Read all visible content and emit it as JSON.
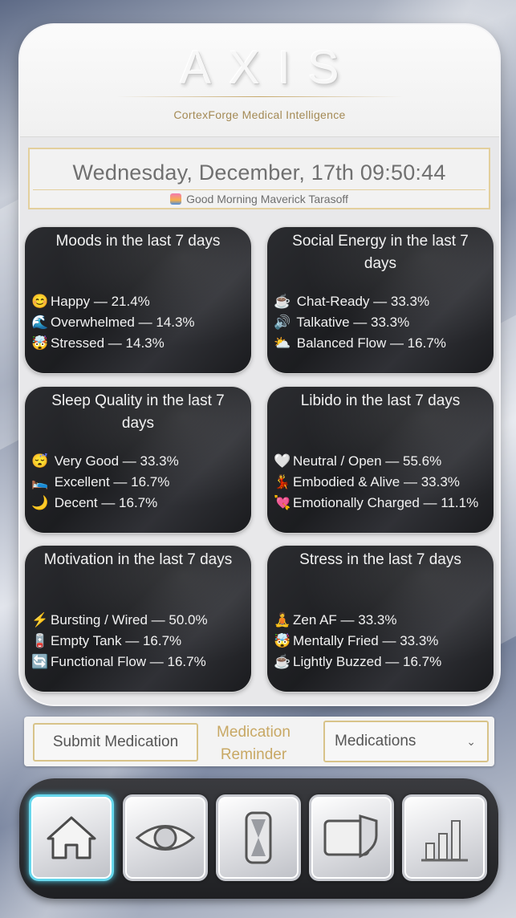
{
  "app": {
    "logo": "AXIS",
    "subtitle": "CortexForge Medical Intelligence"
  },
  "datetime": "Wednesday, December, 17th 09:50:44",
  "greeting": "Good Morning Maverick Tarasoff",
  "cards": [
    {
      "title": "Moods in the last 7 days",
      "items": [
        {
          "icon": "😊",
          "text": "Happy — 21.4%"
        },
        {
          "icon": "🌊",
          "text": "Overwhelmed — 14.3%"
        },
        {
          "icon": "🤯",
          "text": "Stressed — 14.3%"
        }
      ]
    },
    {
      "title": "Social Energy in the last 7 days",
      "items": [
        {
          "icon": "☕",
          "text": "Chat-Ready — 33.3%"
        },
        {
          "icon": "🔊",
          "text": "Talkative — 33.3%"
        },
        {
          "icon": "⛅",
          "text": "Balanced Flow — 16.7%"
        }
      ]
    },
    {
      "title": "Sleep Quality in the last 7 days",
      "items": [
        {
          "icon": "😴",
          "text": "Very Good — 33.3%"
        },
        {
          "icon": "🛌",
          "text": "Excellent — 16.7%"
        },
        {
          "icon": "🌙",
          "text": "Decent — 16.7%"
        }
      ]
    },
    {
      "title": "Libido in the last 7 days",
      "items": [
        {
          "icon": "🤍",
          "text": "Neutral / Open — 55.6%"
        },
        {
          "icon": "💃",
          "text": "Embodied & Alive — 33.3%"
        },
        {
          "icon": "💘",
          "text": "Emotionally Charged — 11.1%"
        }
      ]
    },
    {
      "title": "Motivation in the last 7 days",
      "items": [
        {
          "icon": "⚡",
          "text": "Bursting / Wired — 50.0%"
        },
        {
          "icon": "🪫",
          "text": "Empty Tank — 16.7%"
        },
        {
          "icon": "🔄",
          "text": "Functional Flow — 16.7%"
        }
      ]
    },
    {
      "title": "Stress in the last 7 days",
      "items": [
        {
          "icon": "🧘",
          "text": "Zen AF — 33.3%"
        },
        {
          "icon": "🤯",
          "text": "Mentally Fried — 33.3%"
        },
        {
          "icon": "☕",
          "text": "Lightly Buzzed — 16.7%"
        }
      ]
    }
  ],
  "medication": {
    "submit_label": "Submit Medication",
    "reminder_label": "Medication Reminder",
    "select_value": "Medications"
  },
  "nav": {
    "active": "home",
    "items": [
      "home-icon",
      "eye-icon",
      "hourglass-icon",
      "shield-card-icon",
      "bar-chart-icon"
    ]
  }
}
